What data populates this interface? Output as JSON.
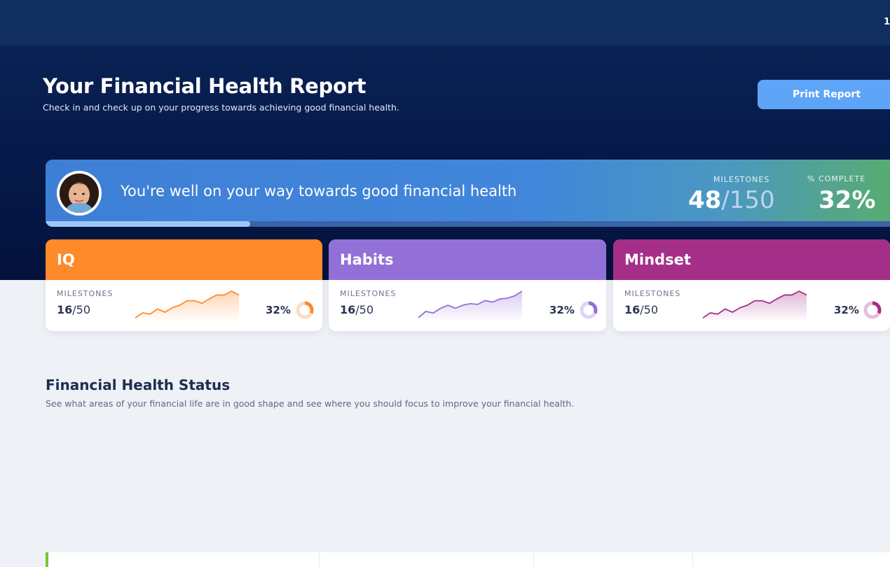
{
  "topbar": {
    "edge_text": "1"
  },
  "header": {
    "title": "Your Financial Health Report",
    "subtitle": "Check in and check up on your progress towards achieving good financial health.",
    "print_label": "Print Report"
  },
  "banner": {
    "avatar_icon": "user-avatar-photo",
    "message": "You're well on your way towards good financial health",
    "milestones_label": "MILESTONES",
    "milestones_done": "48",
    "milestones_sep": "/",
    "milestones_total": "150",
    "complete_label": "% COMPLETE",
    "complete_value": "32%",
    "progress": 0.24
  },
  "cards": [
    {
      "title": "IQ",
      "milestones_label": "MILESTONES",
      "done": "16",
      "sep": "/",
      "total": "50",
      "pct": "32%",
      "progress": 0.32,
      "color": "#ff8a2a",
      "spark": [
        2,
        10,
        8,
        16,
        11,
        18,
        22,
        29,
        29,
        25,
        32,
        38,
        38,
        44,
        38
      ]
    },
    {
      "title": "Habits",
      "milestones_label": "MILESTONES",
      "done": "16",
      "sep": "/",
      "total": "50",
      "pct": "32%",
      "progress": 0.32,
      "color": "#9270d8",
      "spark": [
        2,
        10,
        8,
        14,
        18,
        14,
        18,
        20,
        19,
        24,
        22,
        26,
        27,
        30,
        36
      ]
    },
    {
      "title": "Mindset",
      "milestones_label": "MILESTONES",
      "done": "16",
      "sep": "/",
      "total": "50",
      "pct": "32%",
      "progress": 0.32,
      "color": "#a52f88",
      "spark": [
        2,
        10,
        8,
        16,
        11,
        18,
        22,
        29,
        29,
        25,
        32,
        38,
        38,
        44,
        38
      ]
    }
  ],
  "status": {
    "title": "Financial Health Status",
    "subtitle": "See what areas of your financial life are in good shape and see where you should focus to improve your financial health.",
    "accent": "#7fc234"
  },
  "colors": {
    "hero": "#061a4a",
    "button": "#5ea4f7",
    "banner_start": "#3e7fd6",
    "banner_end": "#58ad6e"
  }
}
